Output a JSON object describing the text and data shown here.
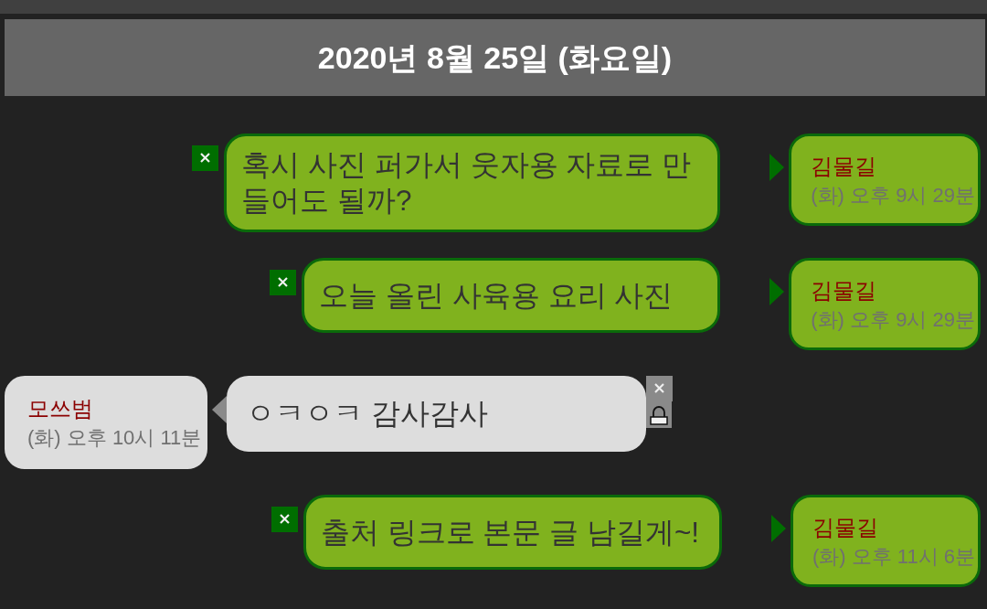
{
  "date_header": {
    "title": "2020년 8월 25일 (화요일)"
  },
  "messages": [
    {
      "kind": "sent",
      "text": "혹시 사진 퍼가서 웃자용 자료로 만들어도 될까?",
      "sender": "김물길",
      "time": "(화) 오후 9시 29분"
    },
    {
      "kind": "sent",
      "text": "오늘 올린 사육용 요리 사진",
      "sender": "김물길",
      "time": "(화) 오후 9시 29분"
    },
    {
      "kind": "received",
      "text": "ㅇㅋㅇㅋ 감사감사",
      "sender": "모쓰범",
      "time": "(화) 오후 10시 11분"
    },
    {
      "kind": "sent",
      "text": "출처 링크로 본문 글 남길게~!",
      "sender": "김물길",
      "time": "(화) 오후 11시 6분"
    }
  ]
}
